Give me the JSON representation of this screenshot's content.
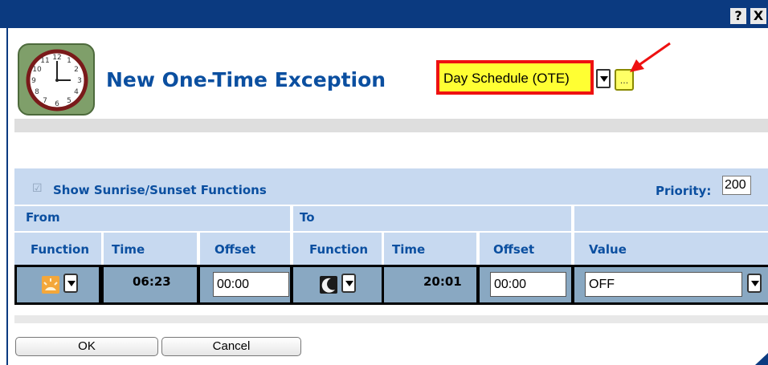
{
  "titlebar": {
    "help": "?",
    "close": "X"
  },
  "dialog": {
    "title": "New One-Time Exception",
    "schedule": {
      "selected": "Day Schedule (OTE)",
      "ellipsis": "..."
    }
  },
  "options": {
    "show_sun_label": "Show Sunrise/Sunset Functions",
    "show_sun_checked": true,
    "priority_label": "Priority:",
    "priority_value": "200"
  },
  "table": {
    "group_from": "From",
    "group_to": "To",
    "columns": [
      "Function",
      "Time",
      "Offset",
      "Function",
      "Time",
      "Offset",
      "Value"
    ],
    "row": {
      "from_function_icon": "sunrise-icon",
      "from_time": "06:23",
      "from_offset": "00:00",
      "to_function_icon": "moon-icon",
      "to_time": "20:01",
      "to_offset": "00:00",
      "value": "OFF"
    }
  },
  "buttons": {
    "ok": "OK",
    "cancel": "Cancel"
  },
  "colors": {
    "titlebar": "#0b3a80",
    "heading_text": "#0b4fa0",
    "highlight_border": "#ee1111",
    "highlight_fill": "#ffff33",
    "header_bg": "#c7d9f0",
    "cell_bg": "#89a8c2"
  }
}
